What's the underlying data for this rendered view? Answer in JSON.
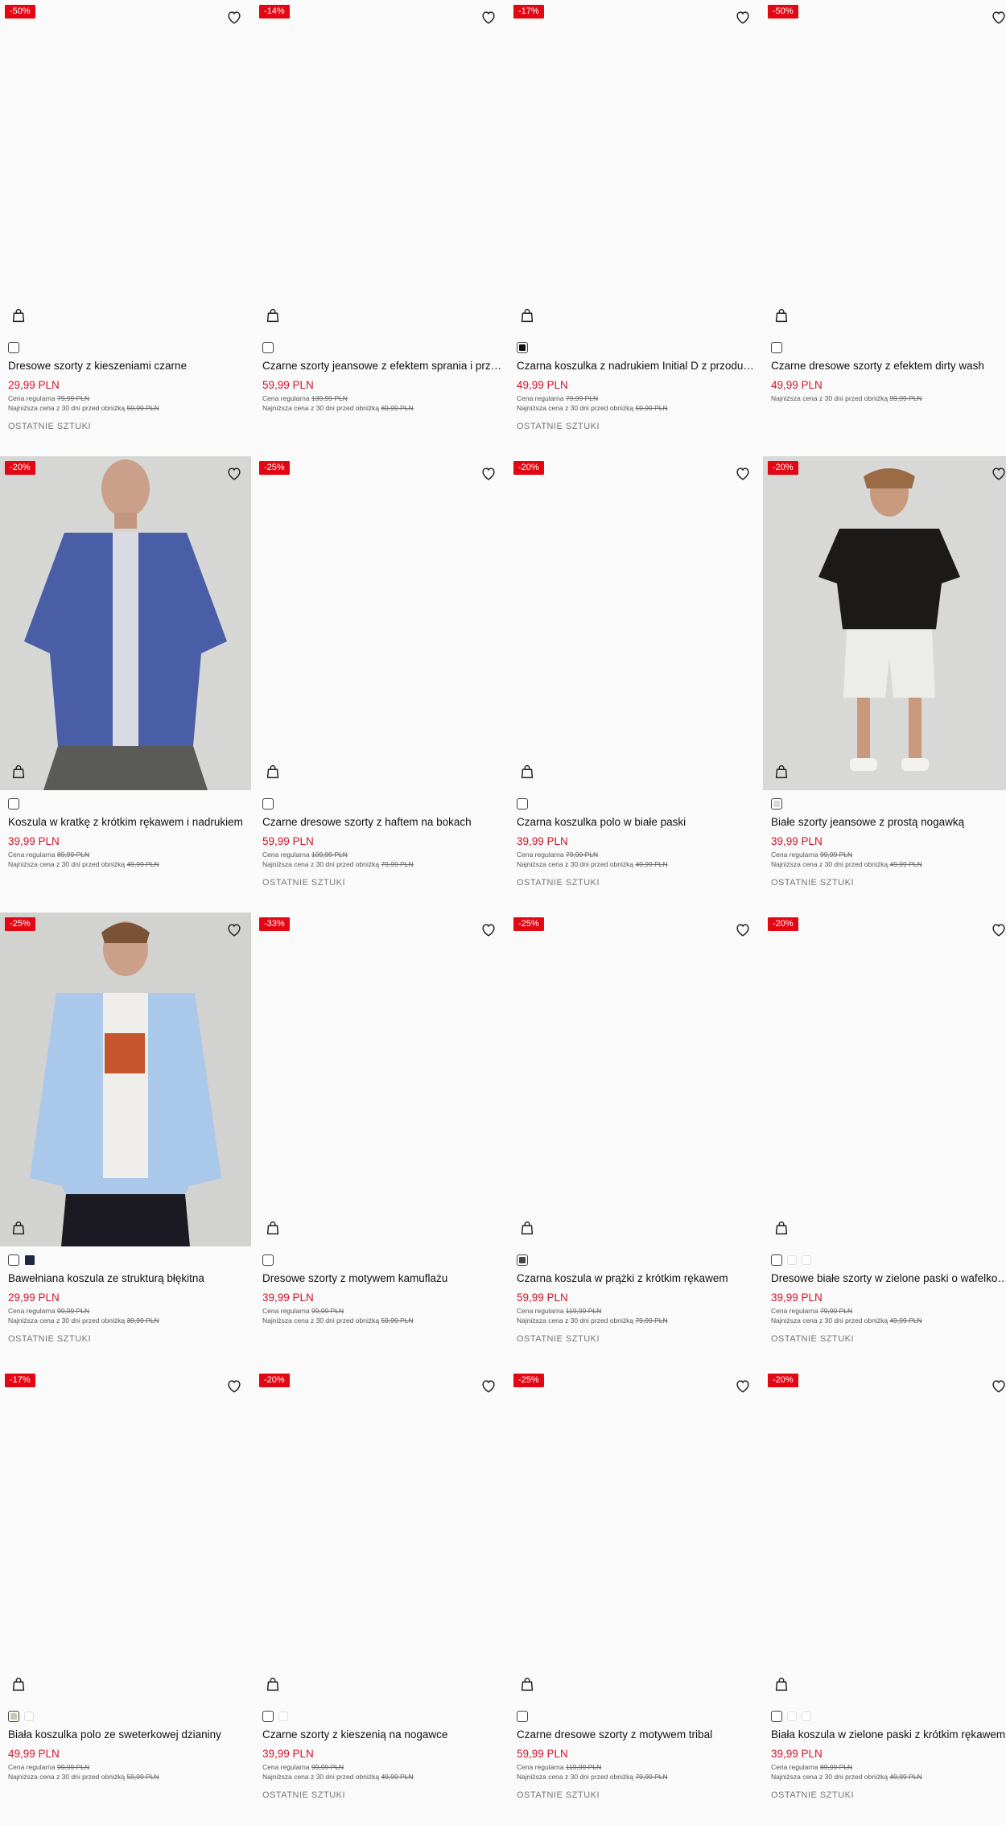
{
  "icons": {
    "wishlist": "heart-icon",
    "cart": "shopping-bag-icon"
  },
  "colors": {
    "badge": "#e30613",
    "price": "#d0142c"
  },
  "regular_label": "Cena regularna",
  "lowest_label": "Najniższa cena z 30 dni przed obniżką",
  "products": [
    {
      "badge": "-50%",
      "title": "Dresowe szorty z kieszeniami czarne",
      "price": "29,99 PLN",
      "regular": "79,99 PLN",
      "lowest": "59,99 PLN",
      "stock": "OSTATNIE SZTUKI",
      "swatches": [
        "#ffffff"
      ]
    },
    {
      "badge": "-14%",
      "title": "Czarne szorty jeansowe z efektem sprania i przetarciami",
      "price": "59,99 PLN",
      "regular": "139,99 PLN",
      "lowest": "69,99 PLN",
      "stock": "",
      "swatches": [
        "#ffffff"
      ]
    },
    {
      "badge": "-17%",
      "title": "Czarna koszulka z nadrukiem Initial D z przodu i na plecach",
      "price": "49,99 PLN",
      "regular": "79,99 PLN",
      "lowest": "59,99 PLN",
      "stock": "OSTATNIE SZTUKI",
      "swatches": [
        "#111111"
      ]
    },
    {
      "badge": "-50%",
      "title": "Czarne dresowe szorty z efektem dirty wash",
      "price": "49,99 PLN",
      "regular": "",
      "lowest": "99,99 PLN",
      "stock": "",
      "swatches": [
        "#ffffff"
      ]
    },
    {
      "badge": "-20%",
      "title": "Koszula w kratkę z krótkim rękawem i nadrukiem",
      "price": "39,99 PLN",
      "regular": "89,99 PLN",
      "lowest": "49,99 PLN",
      "stock": "",
      "swatches": [
        "#ffffff"
      ],
      "photo": "shirt"
    },
    {
      "badge": "-25%",
      "title": "Czarne dresowe szorty z haftem na bokach",
      "price": "59,99 PLN",
      "regular": "109,99 PLN",
      "lowest": "79,99 PLN",
      "stock": "OSTATNIE SZTUKI",
      "swatches": [
        "#ffffff"
      ]
    },
    {
      "badge": "-20%",
      "title": "Czarna koszulka polo w białe paski",
      "price": "39,99 PLN",
      "regular": "79,99 PLN",
      "lowest": "49,99 PLN",
      "stock": "OSTATNIE SZTUKI",
      "swatches": [
        "#ffffff"
      ]
    },
    {
      "badge": "-20%",
      "title": "Białe szorty jeansowe z prostą nogawką",
      "price": "39,99 PLN",
      "regular": "99,99 PLN",
      "lowest": "49,99 PLN",
      "stock": "OSTATNIE SZTUKI",
      "swatches": [
        "#d9d9d9"
      ],
      "photo": "tee"
    },
    {
      "badge": "-25%",
      "title": "Bawełniana koszula ze strukturą błękitna",
      "price": "29,99 PLN",
      "regular": "99,99 PLN",
      "lowest": "39,99 PLN",
      "stock": "OSTATNIE SZTUKI",
      "swatches": [
        "#ffffff",
        "#1e2a44"
      ],
      "photo": "blue"
    },
    {
      "badge": "-33%",
      "title": "Dresowe szorty z motywem kamuflażu",
      "price": "39,99 PLN",
      "regular": "99,99 PLN",
      "lowest": "59,99 PLN",
      "stock": "",
      "swatches": [
        "#ffffff"
      ]
    },
    {
      "badge": "-25%",
      "title": "Czarna koszula w prążki z krótkim rękawem",
      "price": "59,99 PLN",
      "regular": "119,99 PLN",
      "lowest": "79,99 PLN",
      "stock": "OSTATNIE SZTUKI",
      "swatches": [
        "#444444"
      ]
    },
    {
      "badge": "-20%",
      "title": "Dresowe białe szorty w zielone paski o wafelkowej strukturze",
      "price": "39,99 PLN",
      "regular": "79,99 PLN",
      "lowest": "49,99 PLN",
      "stock": "OSTATNIE SZTUKI",
      "swatches": [
        "#ffffff",
        "#f5f5f5",
        "#f5f5f5"
      ]
    },
    {
      "badge": "-17%",
      "title": "Biała koszulka polo ze sweterkowej dzianiny",
      "price": "49,99 PLN",
      "regular": "99,99 PLN",
      "lowest": "59,99 PLN",
      "stock": "",
      "swatches": [
        "#c8c6ad",
        "#f5f5f5"
      ]
    },
    {
      "badge": "-20%",
      "title": "Czarne szorty z kieszenią na nogawce",
      "price": "39,99 PLN",
      "regular": "99,99 PLN",
      "lowest": "49,99 PLN",
      "stock": "OSTATNIE SZTUKI",
      "swatches": [
        "#ffffff",
        "#f5f5f5"
      ]
    },
    {
      "badge": "-25%",
      "title": "Czarne dresowe szorty z motywem tribal",
      "price": "59,99 PLN",
      "regular": "119,99 PLN",
      "lowest": "79,99 PLN",
      "stock": "OSTATNIE SZTUKI",
      "swatches": [
        "#ffffff"
      ]
    },
    {
      "badge": "-20%",
      "title": "Biała koszula w zielone paski z krótkim rękawem",
      "price": "39,99 PLN",
      "regular": "89,99 PLN",
      "lowest": "49,99 PLN",
      "stock": "OSTATNIE SZTUKI",
      "swatches": [
        "#ffffff",
        "#f5f5f5",
        "#f5f5f5"
      ]
    }
  ]
}
